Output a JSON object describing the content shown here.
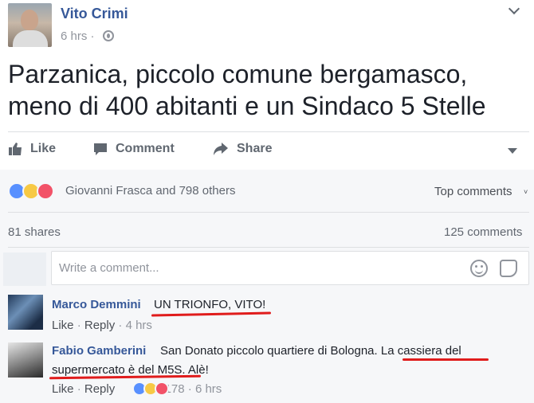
{
  "post": {
    "author": "Vito Crimi",
    "timestamp": "6 hrs ·",
    "text": "Parzanica, piccolo comune bergamasco, meno di 400 abitanti e un Sindaco 5 Stelle"
  },
  "actions": {
    "like": "Like",
    "comment": "Comment",
    "share": "Share"
  },
  "reactions": {
    "types": [
      "like",
      "haha",
      "love"
    ],
    "summary": "Giovanni Frasca and 798 others",
    "sort_label": "Top comments",
    "sort_caret": "˅",
    "shares": "81 shares",
    "comments": "125 comments"
  },
  "comment_box": {
    "placeholder": "Write a comment..."
  },
  "comments": [
    {
      "author": "Marco Demmini",
      "text": "UN TRIONFO, VITO!",
      "like": "Like",
      "reply": "Reply",
      "time": "4 hrs"
    },
    {
      "author": "Fabio Gamberini",
      "text_line1": "San Donato piccolo quartiere di Bologna. La cassiera del",
      "text_line2": "supermercato è del M5S. Alè!",
      "like": "Like",
      "reply": "Reply",
      "reaction_count": "178",
      "time": "6 hrs"
    }
  ],
  "colors": {
    "link_blue": "#365899",
    "annotation_red": "#e01c1c",
    "meta_grey": "#90949c"
  }
}
